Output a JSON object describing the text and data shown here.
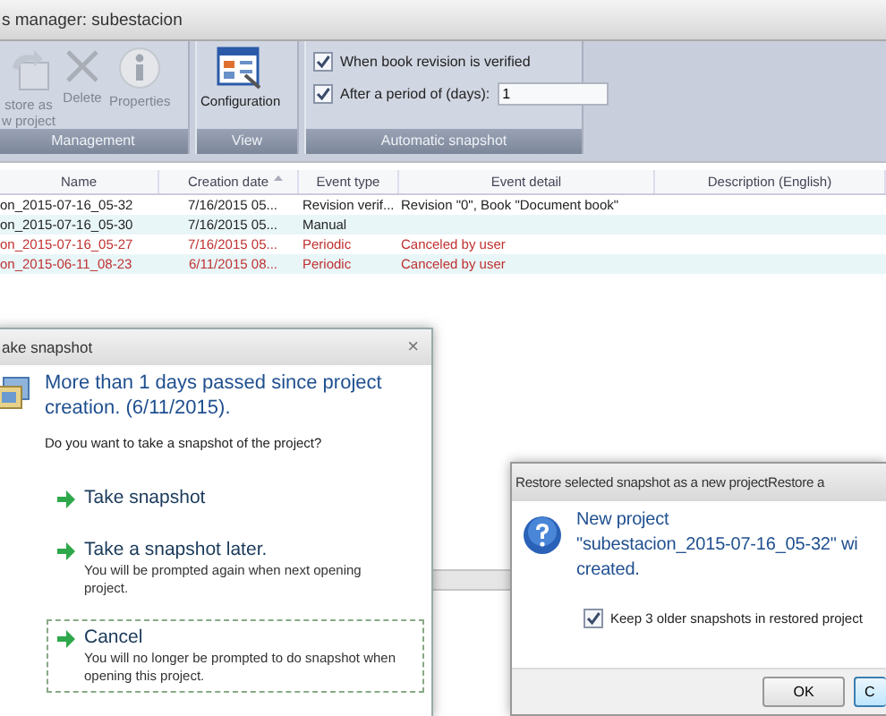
{
  "main_window": {
    "title": "s manager: subestacion"
  },
  "ribbon": {
    "groups": [
      {
        "label": "Management",
        "buttons": [
          {
            "kind": "restore",
            "lines": [
              "store as",
              "w project"
            ],
            "disabled": true
          },
          {
            "kind": "delete",
            "lines": [
              "Delete"
            ],
            "disabled": true
          },
          {
            "kind": "properties",
            "lines": [
              "Properties"
            ],
            "disabled": true
          }
        ]
      },
      {
        "label": "View",
        "buttons": [
          {
            "kind": "configuration",
            "lines": [
              "Configuration"
            ],
            "disabled": false
          }
        ]
      },
      {
        "label": "Automatic snapshot",
        "options": [
          {
            "kind": "checkbox",
            "label": "When book revision is verified",
            "checked": true
          },
          {
            "kind": "checkbox_field",
            "label": "After a period of (days):",
            "checked": true,
            "value": "1"
          }
        ]
      }
    ]
  },
  "table": {
    "columns": [
      {
        "label": "Name",
        "sorted": false
      },
      {
        "label": "Creation date",
        "sorted": true
      },
      {
        "label": "Event type",
        "sorted": false
      },
      {
        "label": "Event detail",
        "sorted": false
      },
      {
        "label": "Description (English)",
        "sorted": false
      }
    ],
    "rows": [
      {
        "canceled": false,
        "cells": [
          "on_2015-07-16_05-32",
          "7/16/2015 05...",
          "Revision verif...",
          "Revision \"0\", Book \"Document book\""
        ]
      },
      {
        "canceled": false,
        "cells": [
          "on_2015-07-16_05-30",
          "7/16/2015 05...",
          "Manual",
          ""
        ]
      },
      {
        "canceled": true,
        "cells": [
          "on_2015-07-16_05-27",
          "7/16/2015 05...",
          "Periodic",
          "Canceled by user"
        ]
      },
      {
        "canceled": true,
        "cells": [
          "on_2015-06-11_08-23",
          "6/11/2015 08...",
          "Periodic",
          "Canceled by user"
        ]
      }
    ]
  },
  "take_snapshot_dialog": {
    "title": "ake snapshot",
    "close": "×",
    "heading": "More than 1 days passed since project creation. (6/11/2015).",
    "question": "Do you want to take a snapshot of the project?",
    "options": [
      {
        "title": "Take snapshot",
        "focused": false
      },
      {
        "title": "Take a snapshot later.",
        "note": "You will be prompted again when next opening project.",
        "focused": false
      },
      {
        "title": "Cancel",
        "note": "You will no longer be prompted to do snapshot when opening this project.",
        "focused": true
      }
    ]
  },
  "restore_dialog": {
    "title": "Restore selected snapshot as a new projectRestore a",
    "message_lines": [
      "New project",
      "\"subestacion_2015-07-16_05-32\" wi",
      "created."
    ],
    "checkbox": {
      "label": "Keep 3 older snapshots in restored project",
      "checked": true
    },
    "buttons": [
      "OK",
      "C"
    ]
  }
}
